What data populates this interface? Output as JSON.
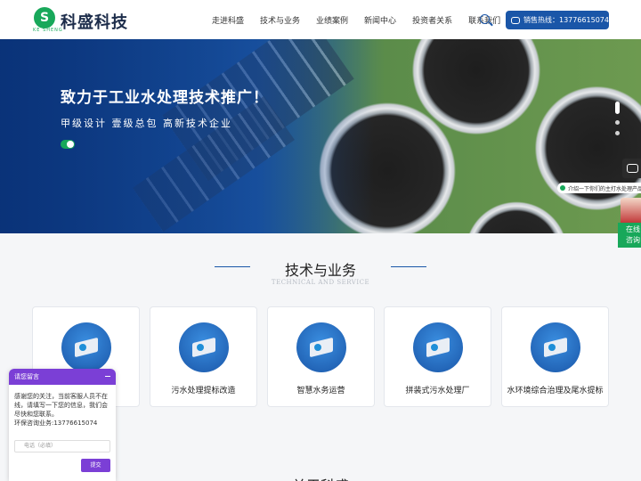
{
  "header": {
    "brand": "科盛科技",
    "logo_sub": "KE SHENG",
    "nav": [
      "走进科盛",
      "技术与业务",
      "业绩案例",
      "新闻中心",
      "投资者关系",
      "联系我们"
    ],
    "hotline": "销售热线：13776615074"
  },
  "hero": {
    "title": "致力于工业水处理技术推广！",
    "subtitle": "甲级设计  壹级总包  高新技术企业"
  },
  "side": {
    "promo": "介绍一下你们的主打水处理产品",
    "online": "在线咨询"
  },
  "section": {
    "title": "技术与业务",
    "subtitle_en": "TECHNICAL AND SERVICE",
    "cards": [
      {
        "label": "理"
      },
      {
        "label": "污水处理提标改造"
      },
      {
        "label": "智慧水务运营"
      },
      {
        "label": "拼装式污水处理厂"
      },
      {
        "label": "水环境综合治理及尾水提标"
      }
    ]
  },
  "chat": {
    "title": "请您留言",
    "message": "感谢您的关注，当前客服人员不在线，请填写一下您的信息，我们会尽快和您联系。",
    "contact": "环保咨询业务:13776615074",
    "phone_placeholder": "电话（必填）",
    "submit": "提交"
  },
  "next_section": {
    "title": "关于科盛"
  }
}
